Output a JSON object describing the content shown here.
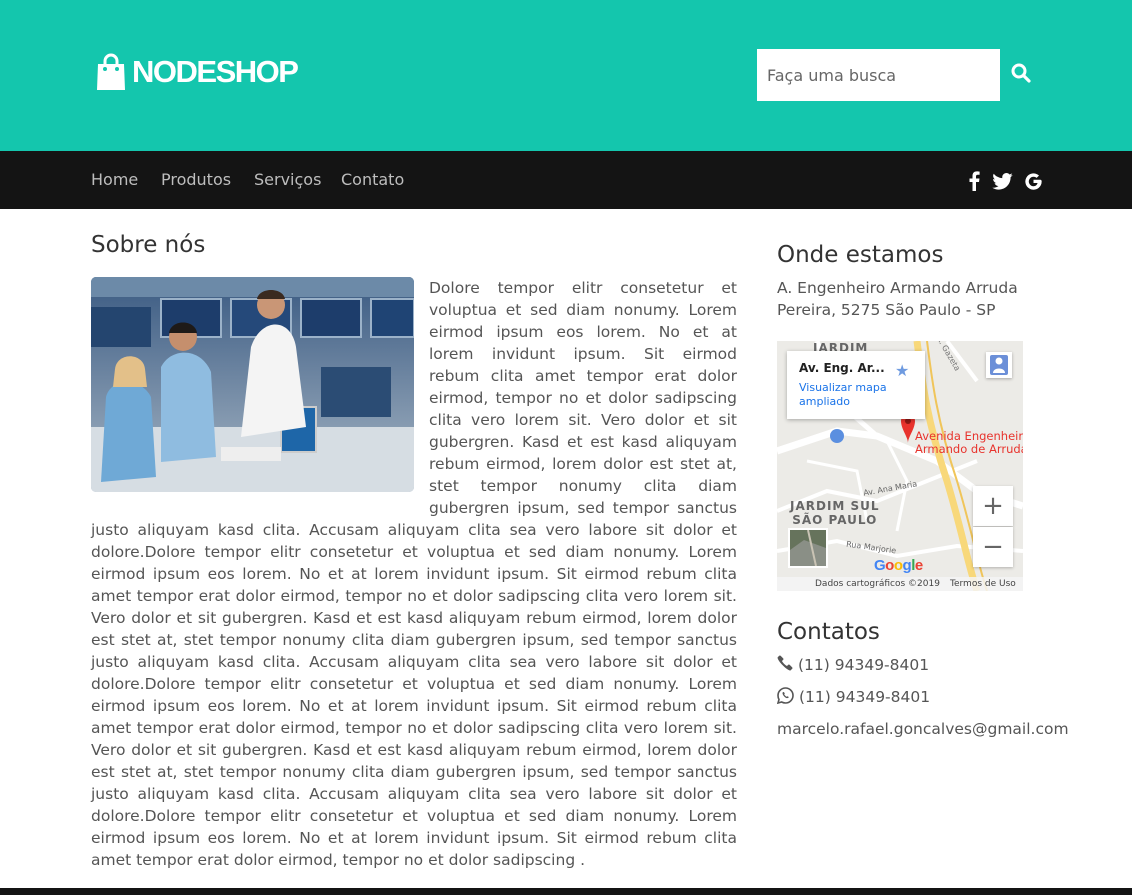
{
  "header": {
    "brand": "NODESHOP",
    "search_placeholder": "Faça uma busca",
    "bag_icon": "shopping-bag-icon",
    "search_icon": "search-icon"
  },
  "nav": {
    "items": [
      "Home",
      "Produtos",
      "Serviços",
      "Contato"
    ],
    "social": [
      "facebook-icon",
      "twitter-icon",
      "google-icon"
    ]
  },
  "about": {
    "title": "Sobre nós",
    "photo": "store-photo",
    "text": "Dolore tempor elitr consetetur et voluptua et sed diam nonumy. Lorem eirmod ipsum eos lorem. No et at lorem invidunt ipsum. Sit eirmod rebum clita amet tempor erat dolor eirmod, tempor no et dolor sadipscing clita vero lorem sit. Vero dolor et sit gubergren. Kasd et est kasd aliquyam rebum eirmod, lorem dolor est stet at, stet tempor nonumy clita diam gubergren ipsum, sed tempor sanctus justo aliquyam kasd clita. Accusam aliquyam clita sea vero labore sit dolor et dolore.Dolore tempor elitr consetetur et voluptua et sed diam nonumy. Lorem eirmod ipsum eos lorem. No et at lorem invidunt ipsum. Sit eirmod rebum clita amet tempor erat dolor eirmod, tempor no et dolor sadipscing clita vero lorem sit. Vero dolor et sit gubergren. Kasd et est kasd aliquyam rebum eirmod, lorem dolor est stet at, stet tempor nonumy clita diam gubergren ipsum, sed tempor sanctus justo aliquyam kasd clita. Accusam aliquyam clita sea vero labore sit dolor et dolore.Dolore tempor elitr consetetur et voluptua et sed diam nonumy. Lorem eirmod ipsum eos lorem. No et at lorem invidunt ipsum. Sit eirmod rebum clita amet tempor erat dolor eirmod, tempor no et dolor sadipscing clita vero lorem sit. Vero dolor et sit gubergren. Kasd et est kasd aliquyam rebum eirmod, lorem dolor est stet at, stet tempor nonumy clita diam gubergren ipsum, sed tempor sanctus justo aliquyam kasd clita. Accusam aliquyam clita sea vero labore sit dolor et dolore.Dolore tempor elitr consetetur et voluptua et sed diam nonumy. Lorem eirmod ipsum eos lorem. No et at lorem invidunt ipsum. Sit eirmod rebum clita amet tempor erat dolor eirmod, tempor no et dolor sadipscing ."
  },
  "location": {
    "title": "Onde estamos",
    "address": "A. Engenheiro Armando Arruda Pereira, 5275 São Paulo - SP",
    "map": {
      "card_title": "Av. Eng. Ar...",
      "card_link": "Visualizar mapa ampliado",
      "neighborhood_top": "JARDIM",
      "neighborhood": "JARDIM SUL",
      "neighborhood_2": "SÃO PAULO",
      "street_1": "Av. Ana Maria",
      "street_2": "Rua Marjorie",
      "street_3": "R. Gazeta",
      "pin_label_1": "Avenida Engenheiro",
      "pin_label_2": "Armando de Arruda",
      "zoom_in": "+",
      "zoom_out": "−",
      "google": "Google",
      "footer_data": "Dados cartográficos ©2019",
      "footer_terms": "Termos de Uso",
      "pin_color": "#e8332d"
    }
  },
  "contacts": {
    "title": "Contatos",
    "phone": "(11) 94349-8401",
    "whatsapp": "(11) 94349-8401",
    "email": "marcelo.rafael.goncalves@gmail.com"
  },
  "colors": {
    "header": "#14c6ad",
    "nav": "#141414"
  }
}
